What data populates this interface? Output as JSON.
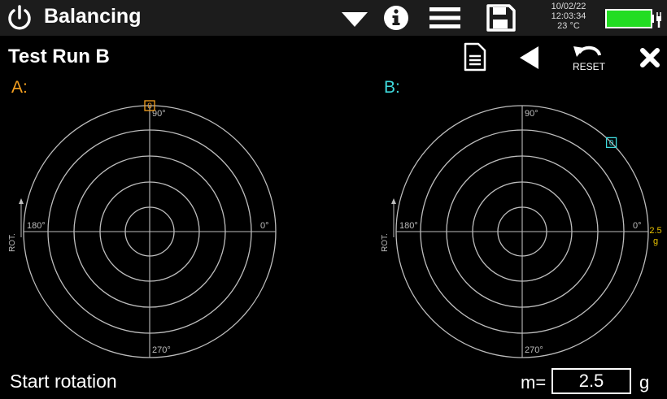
{
  "header": {
    "title": "Balancing",
    "date": "10/02/22",
    "time": "12:03:34",
    "temperature": "23 °C",
    "icons": [
      "power-icon",
      "caret-down-icon",
      "info-icon",
      "hamburger-menu-icon",
      "floppy-save-icon",
      "battery-plug-icon"
    ],
    "battery_color": "#22dd22"
  },
  "toolbar": {
    "page_title": "Test Run B",
    "reset_label": "RESET",
    "icons": [
      "document-icon",
      "back-triangle-icon",
      "undo-arrow-icon",
      "close-x-icon"
    ]
  },
  "planes": {
    "a": {
      "label": "A:",
      "color": "#f5a020",
      "deg_top": "90°",
      "deg_left": "180°",
      "deg_right": "0°",
      "deg_bottom": "270°",
      "rot_label": "ROT.",
      "marker_label": "0",
      "marker_angle_deg": 90,
      "marker_radius_fraction": 1.0
    },
    "b": {
      "label": "B:",
      "color": "#3fd9dc",
      "deg_top": "90°",
      "deg_left": "180°",
      "deg_right": "0°",
      "deg_bottom": "270°",
      "rot_label": "ROT.",
      "marker_label": "0",
      "marker_angle_deg": 45,
      "marker_radius_fraction": 1.0
    }
  },
  "scale": {
    "value": "2.5",
    "unit": "g"
  },
  "footer": {
    "status": "Start rotation",
    "mass_label": "m=",
    "mass_value": "2.5",
    "mass_unit": "g"
  }
}
